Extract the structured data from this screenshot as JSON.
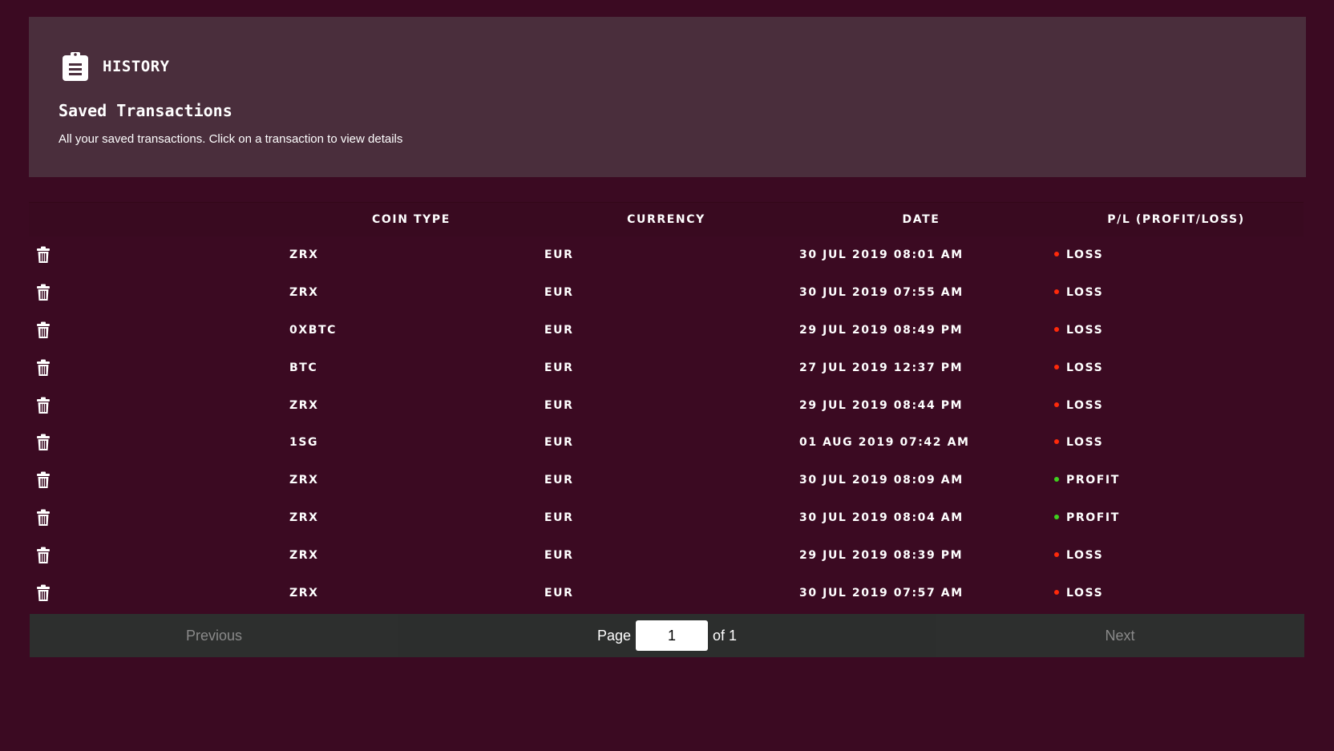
{
  "header": {
    "title": "HISTORY",
    "subtitle": "Saved Transactions",
    "description": "All your saved transactions. Click on a transaction to view details"
  },
  "table": {
    "columns": [
      "",
      "COIN TYPE",
      "CURRENCY",
      "DATE",
      "P/L (PROFIT/LOSS)"
    ],
    "rows": [
      {
        "coin": "ZRX",
        "currency": "EUR",
        "date": "30 JUL 2019 08:01 AM",
        "pl": "LOSS"
      },
      {
        "coin": "ZRX",
        "currency": "EUR",
        "date": "30 JUL 2019 07:55 AM",
        "pl": "LOSS"
      },
      {
        "coin": "0XBTC",
        "currency": "EUR",
        "date": "29 JUL 2019 08:49 PM",
        "pl": "LOSS"
      },
      {
        "coin": "BTC",
        "currency": "EUR",
        "date": "27 JUL 2019 12:37 PM",
        "pl": "LOSS"
      },
      {
        "coin": "ZRX",
        "currency": "EUR",
        "date": "29 JUL 2019 08:44 PM",
        "pl": "LOSS"
      },
      {
        "coin": "1SG",
        "currency": "EUR",
        "date": "01 AUG 2019 07:42 AM",
        "pl": "LOSS"
      },
      {
        "coin": "ZRX",
        "currency": "EUR",
        "date": "30 JUL 2019 08:09 AM",
        "pl": "PROFIT"
      },
      {
        "coin": "ZRX",
        "currency": "EUR",
        "date": "30 JUL 2019 08:04 AM",
        "pl": "PROFIT"
      },
      {
        "coin": "ZRX",
        "currency": "EUR",
        "date": "29 JUL 2019 08:39 PM",
        "pl": "LOSS"
      },
      {
        "coin": "ZRX",
        "currency": "EUR",
        "date": "30 JUL 2019 07:57 AM",
        "pl": "LOSS"
      }
    ]
  },
  "pagination": {
    "previous": "Previous",
    "page_label": "Page",
    "page_value": "1",
    "of_label": "of 1",
    "next": "Next"
  },
  "colors": {
    "loss": "#ff2a0a",
    "profit": "#3fd01e"
  }
}
